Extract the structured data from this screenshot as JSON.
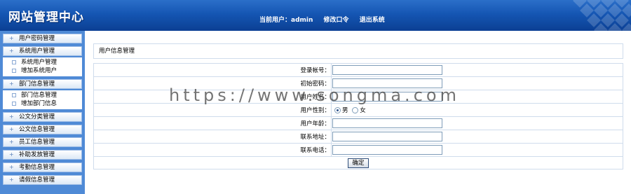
{
  "header": {
    "title": "网站管理中心",
    "current_user_label": "当前用户：admin",
    "change_password": "修改口令",
    "logout": "退出系统"
  },
  "sidebar": {
    "items": [
      {
        "label": "用户密码管理",
        "children": []
      },
      {
        "label": "系统用户管理",
        "children": [
          "系统用户管理",
          "增加系统用户"
        ]
      },
      {
        "label": "部门信息管理",
        "children": [
          "部门信息管理",
          "增加部门信息"
        ]
      },
      {
        "label": "公文分类管理",
        "children": []
      },
      {
        "label": "公文信息管理",
        "children": []
      },
      {
        "label": "员工信息管理",
        "children": []
      },
      {
        "label": "补助发放管理",
        "children": []
      },
      {
        "label": "考勤信息管理",
        "children": []
      },
      {
        "label": "请假信息管理",
        "children": []
      }
    ]
  },
  "main": {
    "panel_title": "用户信息管理",
    "form": {
      "login_label": "登录帐号：",
      "login_value": "",
      "password_label": "初始密码：",
      "password_value": "",
      "name_label": "用户姓名：",
      "name_value": "",
      "gender_label": "用户性别：",
      "gender_options": [
        "男",
        "女"
      ],
      "gender_selected": "男",
      "age_label": "用户年龄：",
      "age_value": "",
      "address_label": "联系地址：",
      "address_value": "",
      "phone_label": "联系电话：",
      "phone_value": "",
      "submit_label": "确定"
    }
  },
  "watermark": "https://www.songma.com"
}
